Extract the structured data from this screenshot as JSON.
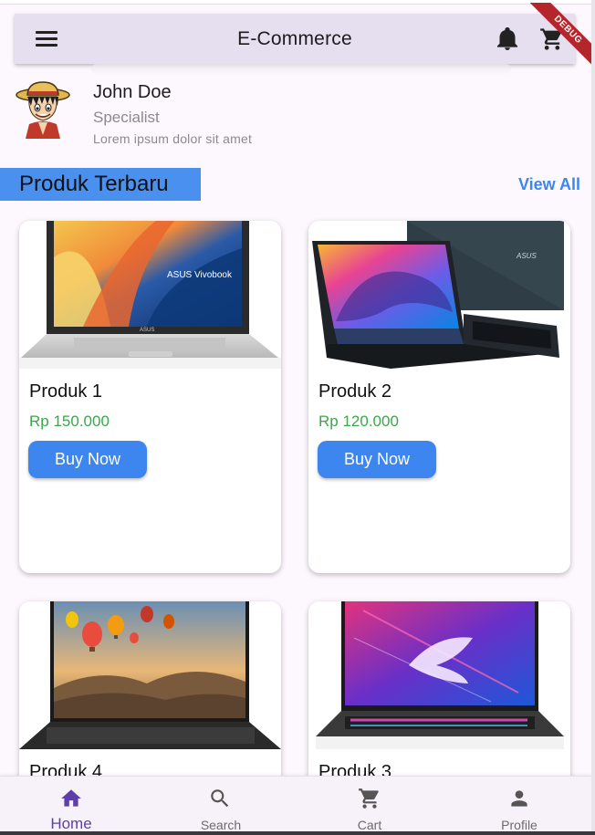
{
  "app_bar": {
    "title": "E-Commerce",
    "icons": [
      "menu-icon",
      "notification-bell-icon",
      "shopping-cart-icon"
    ]
  },
  "debug_banner": "DEBUG",
  "user": {
    "name": "John Doe",
    "role": "Specialist",
    "description": "Lorem ipsum dolor sit amet"
  },
  "section": {
    "title": "Produk Terbaru",
    "view_all": "View All"
  },
  "products": [
    {
      "name": "Produk 1",
      "price": "Rp 150.000",
      "button": "Buy Now",
      "image_text": "ASUS Vivobook",
      "brand": "ASUS"
    },
    {
      "name": "Produk 2",
      "price": "Rp 120.000",
      "button": "Buy Now",
      "brand": "ASUS"
    },
    {
      "name": "Produk 4"
    },
    {
      "name": "Produk 3"
    }
  ],
  "bottom_nav": [
    {
      "label": "Home",
      "icon": "home-icon",
      "active": true
    },
    {
      "label": "Search",
      "icon": "search-icon",
      "active": false
    },
    {
      "label": "Cart",
      "icon": "cart-icon",
      "active": false
    },
    {
      "label": "Profile",
      "icon": "person-icon",
      "active": false
    }
  ],
  "colors": {
    "background": "#fdf7fe",
    "app_bar": "#e6dfef",
    "accent_blue": "#3d86f0",
    "section_bg": "#4a90ef",
    "price_green": "#3aa84a",
    "nav_active": "#5c3fa8",
    "debug_red": "#b5262c"
  }
}
